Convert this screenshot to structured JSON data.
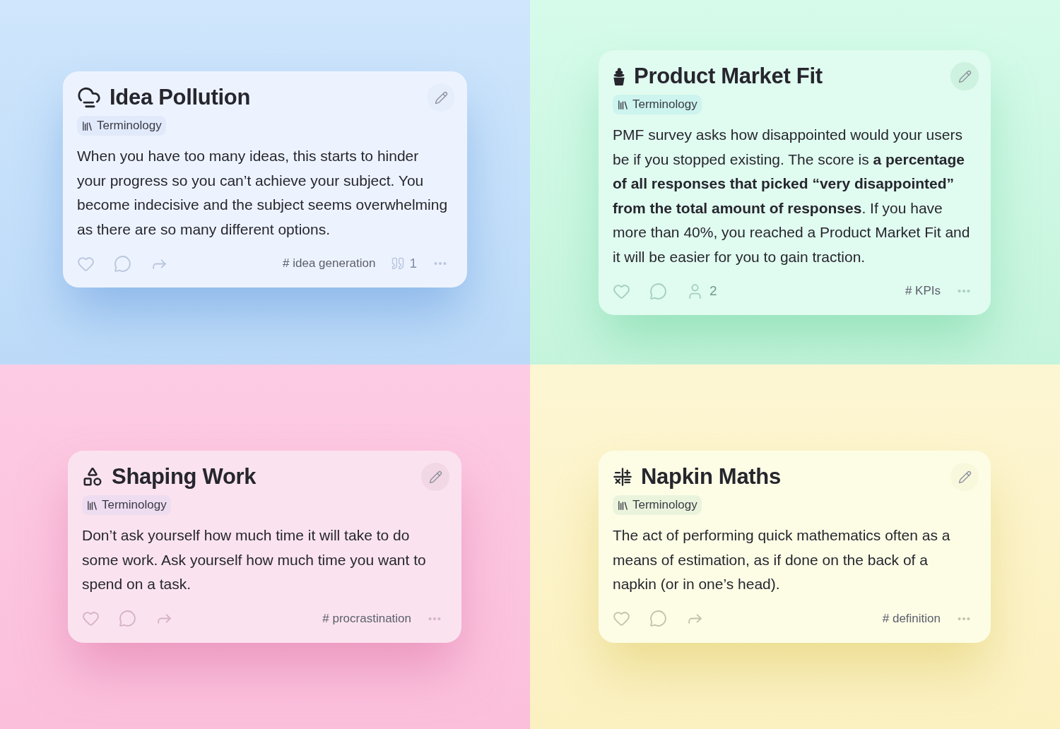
{
  "rows": [
    {
      "cards": [
        {
          "title": "Idea Pollution",
          "tag": "Terminology",
          "body": "When you have too many ideas, this starts to hinder your progress so you can’t achieve your subject. You become indecisive and the subject seems overwhelming as there are so many different options.",
          "actions": [
            {
              "kind": "like"
            },
            {
              "kind": "comment"
            },
            {
              "kind": "share"
            }
          ],
          "hashtag": "# idea generation",
          "quotes": "1"
        },
        {
          "title": "Product Market Fit",
          "tag": "Terminology",
          "body": "PMF survey asks how disappointed would your users be if you stopped existing. The score is **a percentage of all responses that picked “very disappointed” from the total amount of responses**. If you have more than 40%, you reached a Product Market Fit and it will be easier for you to gain traction.",
          "actions": [
            {
              "kind": "like"
            },
            {
              "kind": "comment"
            },
            {
              "kind": "people",
              "count": "2"
            }
          ],
          "hashtag": "# KPIs"
        }
      ]
    },
    {
      "cards": [
        {
          "title": "Shaping Work",
          "tag": "Terminology",
          "body": "Don’t ask yourself how much time it will take to do some work. Ask yourself how much time you want to spend on a task.",
          "actions": [
            {
              "kind": "like"
            },
            {
              "kind": "comment"
            },
            {
              "kind": "share"
            }
          ],
          "hashtag": "# procrastination"
        },
        {
          "title": "Napkin Maths",
          "tag": "Terminology",
          "body": "The act of performing quick mathematics often as a means of estimation, as if done on the back of a napkin (or in one’s head).",
          "actions": [
            {
              "kind": "like"
            },
            {
              "kind": "comment"
            },
            {
              "kind": "share"
            }
          ],
          "hashtag": "# definition"
        }
      ]
    }
  ]
}
